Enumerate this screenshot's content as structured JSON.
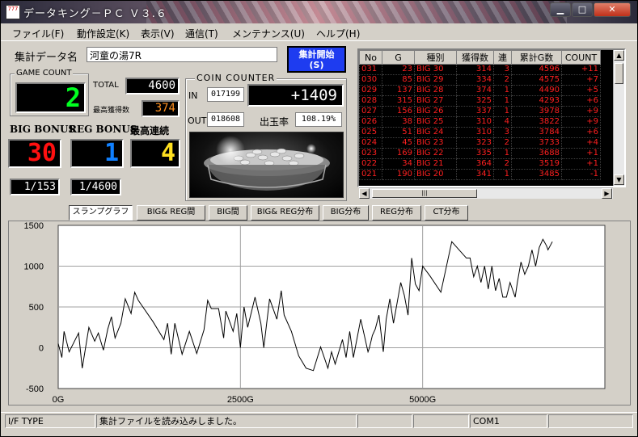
{
  "window": {
    "title": "データキング－ＰＣ Ｖ３.６",
    "icon_text": "777"
  },
  "menu": [
    "ファイル(F)",
    "動作設定(K)",
    "表示(V)",
    "通信(T)",
    "メンテナンス(U)",
    "ヘルプ(H)"
  ],
  "header": {
    "file_label": "集計データ名",
    "file_name": "河童の湯7R",
    "start_button": "集計開始\n(S)"
  },
  "stats": {
    "game_count_title": "GAME COUNT",
    "game_count": "2",
    "total_label": "TOTAL",
    "total": "4600",
    "max_label": "最高獲得数",
    "max_gain": "374",
    "big_label": "BIG BONUS",
    "reg_label": "REG BONUS",
    "renzoku_label": "最高連続",
    "big": "30",
    "reg": "1",
    "renzoku": "4",
    "big_prob": "1/153",
    "reg_prob": "1/4600"
  },
  "coin": {
    "title": "COIN COUNTER",
    "in_label": "IN",
    "in": "017199",
    "out_label": "OUT",
    "out": "018608",
    "diff": "+1409",
    "rate_label": "出玉率",
    "rate": "108.19%"
  },
  "table": {
    "headers": [
      "No",
      "G",
      "種別",
      "獲得数",
      "連",
      "累計G数",
      "COUNT"
    ],
    "rows": [
      [
        "031",
        "23",
        "BIG 30",
        "314",
        "3",
        "4596",
        "+11"
      ],
      [
        "030",
        "85",
        "BIG 29",
        "334",
        "2",
        "4575",
        "+7"
      ],
      [
        "029",
        "137",
        "BIG 28",
        "374",
        "1",
        "4490",
        "+5"
      ],
      [
        "028",
        "315",
        "BIG 27",
        "325",
        "1",
        "4293",
        "+6"
      ],
      [
        "027",
        "156",
        "BIG 26",
        "337",
        "1",
        "3978",
        "+9"
      ],
      [
        "026",
        "38",
        "BIG 25",
        "310",
        "4",
        "3822",
        "+9"
      ],
      [
        "025",
        "51",
        "BIG 24",
        "310",
        "3",
        "3784",
        "+6"
      ],
      [
        "024",
        "45",
        "BIG 23",
        "323",
        "2",
        "3733",
        "+4"
      ],
      [
        "023",
        "169",
        "BIG 22",
        "335",
        "1",
        "3688",
        "+1"
      ],
      [
        "022",
        "34",
        "BIG 21",
        "364",
        "2",
        "3519",
        "+1"
      ],
      [
        "021",
        "190",
        "BIG 20",
        "341",
        "1",
        "3485",
        "-1"
      ]
    ]
  },
  "graph_tabs": [
    "スランプグラフ",
    "BIG& REG間",
    "BIG間",
    "BIG& REG分布",
    "BIG分布",
    "REG分布",
    "CT分布"
  ],
  "status": {
    "if_type": "I/F TYPE",
    "message": "集計ファイルを読み込みしました。",
    "port": "COM1"
  },
  "chart_data": {
    "type": "line",
    "title": "",
    "xlabel": "",
    "ylabel": "",
    "xlim": [
      0,
      7500
    ],
    "ylim": [
      -500,
      1500
    ],
    "x_ticks": [
      "0G",
      "2500G",
      "5000G"
    ],
    "y_ticks": [
      "1500",
      "1000",
      "500",
      "0",
      "-500"
    ],
    "grid": true,
    "series": [
      {
        "x": [
          0,
          50,
          80,
          150,
          280,
          330,
          420,
          500,
          550,
          620,
          680,
          730,
          780,
          860,
          920,
          1000,
          1050,
          1100,
          1300,
          1450,
          1500,
          1550,
          1600,
          1700,
          1800,
          1900,
          2000,
          2050,
          2100,
          2200,
          2270,
          2300,
          2400,
          2450,
          2500,
          2550,
          2600,
          2700,
          2780,
          2820,
          2900,
          3000,
          3060,
          3100,
          3200,
          3300,
          3400,
          3500,
          3600,
          3700,
          3750,
          3800,
          3900,
          3950,
          4000,
          4050,
          4150,
          4250,
          4270,
          4310,
          4350,
          4400,
          4460,
          4500,
          4550,
          4600,
          4700,
          4750,
          4800,
          4850,
          4900,
          4950,
          5000,
          5100,
          5250,
          5400,
          5500,
          5600,
          5650,
          5700,
          5750,
          5800,
          5850,
          5900,
          5950,
          6000,
          6050,
          6100,
          6150,
          6200,
          6270,
          6300,
          6350,
          6400,
          6450,
          6500,
          6550,
          6600,
          6650,
          6700,
          6720,
          6780
        ],
        "y": [
          50,
          -120,
          200,
          -50,
          180,
          -250,
          250,
          80,
          180,
          -30,
          230,
          380,
          120,
          300,
          600,
          420,
          680,
          580,
          320,
          100,
          300,
          -80,
          300,
          -80,
          200,
          -70,
          220,
          580,
          480,
          480,
          120,
          450,
          200,
          420,
          0,
          500,
          250,
          620,
          300,
          0,
          600,
          350,
          700,
          400,
          200,
          -100,
          -250,
          -280,
          10,
          -250,
          -50,
          -200,
          100,
          -120,
          200,
          -120,
          350,
          -50,
          0,
          150,
          230,
          400,
          -50,
          350,
          600,
          300,
          800,
          640,
          400,
          1100,
          780,
          700,
          1000,
          880,
          680,
          1300,
          1200,
          1100,
          1100,
          870,
          1000,
          800,
          1000,
          720,
          1000,
          700,
          850,
          620,
          620,
          800,
          620,
          800,
          1050,
          900,
          1000,
          1200,
          1000,
          1230,
          1330,
          1250,
          1200,
          1300
        ]
      }
    ]
  }
}
